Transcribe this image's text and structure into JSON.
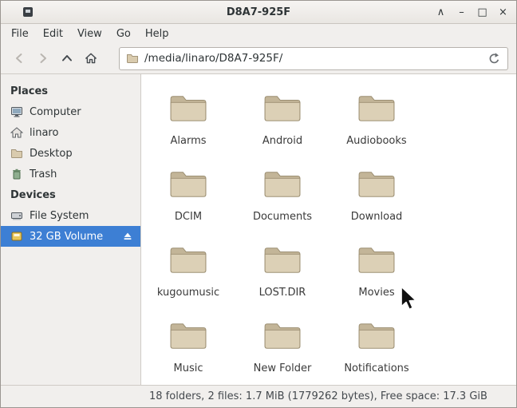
{
  "window": {
    "title": "D8A7-925F",
    "controls": [
      {
        "name": "shade",
        "glyph": "∧"
      },
      {
        "name": "minimize",
        "glyph": "–"
      },
      {
        "name": "maximize",
        "glyph": "□"
      },
      {
        "name": "close",
        "glyph": "×"
      }
    ]
  },
  "menubar": {
    "items": [
      "File",
      "Edit",
      "View",
      "Go",
      "Help"
    ]
  },
  "toolbar": {
    "buttons": [
      {
        "name": "back",
        "icon": "back-icon",
        "enabled": false
      },
      {
        "name": "forward",
        "icon": "forward-icon",
        "enabled": false
      },
      {
        "name": "up",
        "icon": "up-icon",
        "enabled": true
      },
      {
        "name": "home",
        "icon": "home-icon",
        "enabled": true
      }
    ],
    "path": "/media/linaro/D8A7-925F/"
  },
  "sidebar": {
    "sections": [
      {
        "header": "Places",
        "items": [
          {
            "label": "Computer",
            "icon": "computer-icon"
          },
          {
            "label": "linaro",
            "icon": "home-folder-icon"
          },
          {
            "label": "Desktop",
            "icon": "folder-icon"
          },
          {
            "label": "Trash",
            "icon": "trash-icon"
          }
        ]
      },
      {
        "header": "Devices",
        "items": [
          {
            "label": "File System",
            "icon": "harddisk-icon"
          },
          {
            "label": "32 GB Volume",
            "icon": "usb-volume-icon",
            "selected": true,
            "ejectable": true
          }
        ]
      }
    ]
  },
  "files": {
    "folders": [
      "Alarms",
      "Android",
      "Audiobooks",
      "DCIM",
      "Documents",
      "Download",
      "kugoumusic",
      "LOST.DIR",
      "Movies",
      "Music",
      "New Folder",
      "Notifications"
    ]
  },
  "statusbar": {
    "text": "18 folders, 2 files: 1.7 MiB (1779262 bytes), Free space: 17.3 GiB"
  },
  "colors": {
    "selection": "#3d7fd4",
    "folder_front": "#dcd0b6",
    "folder_back": "#c3b598",
    "folder_stroke": "#9b8e72"
  }
}
